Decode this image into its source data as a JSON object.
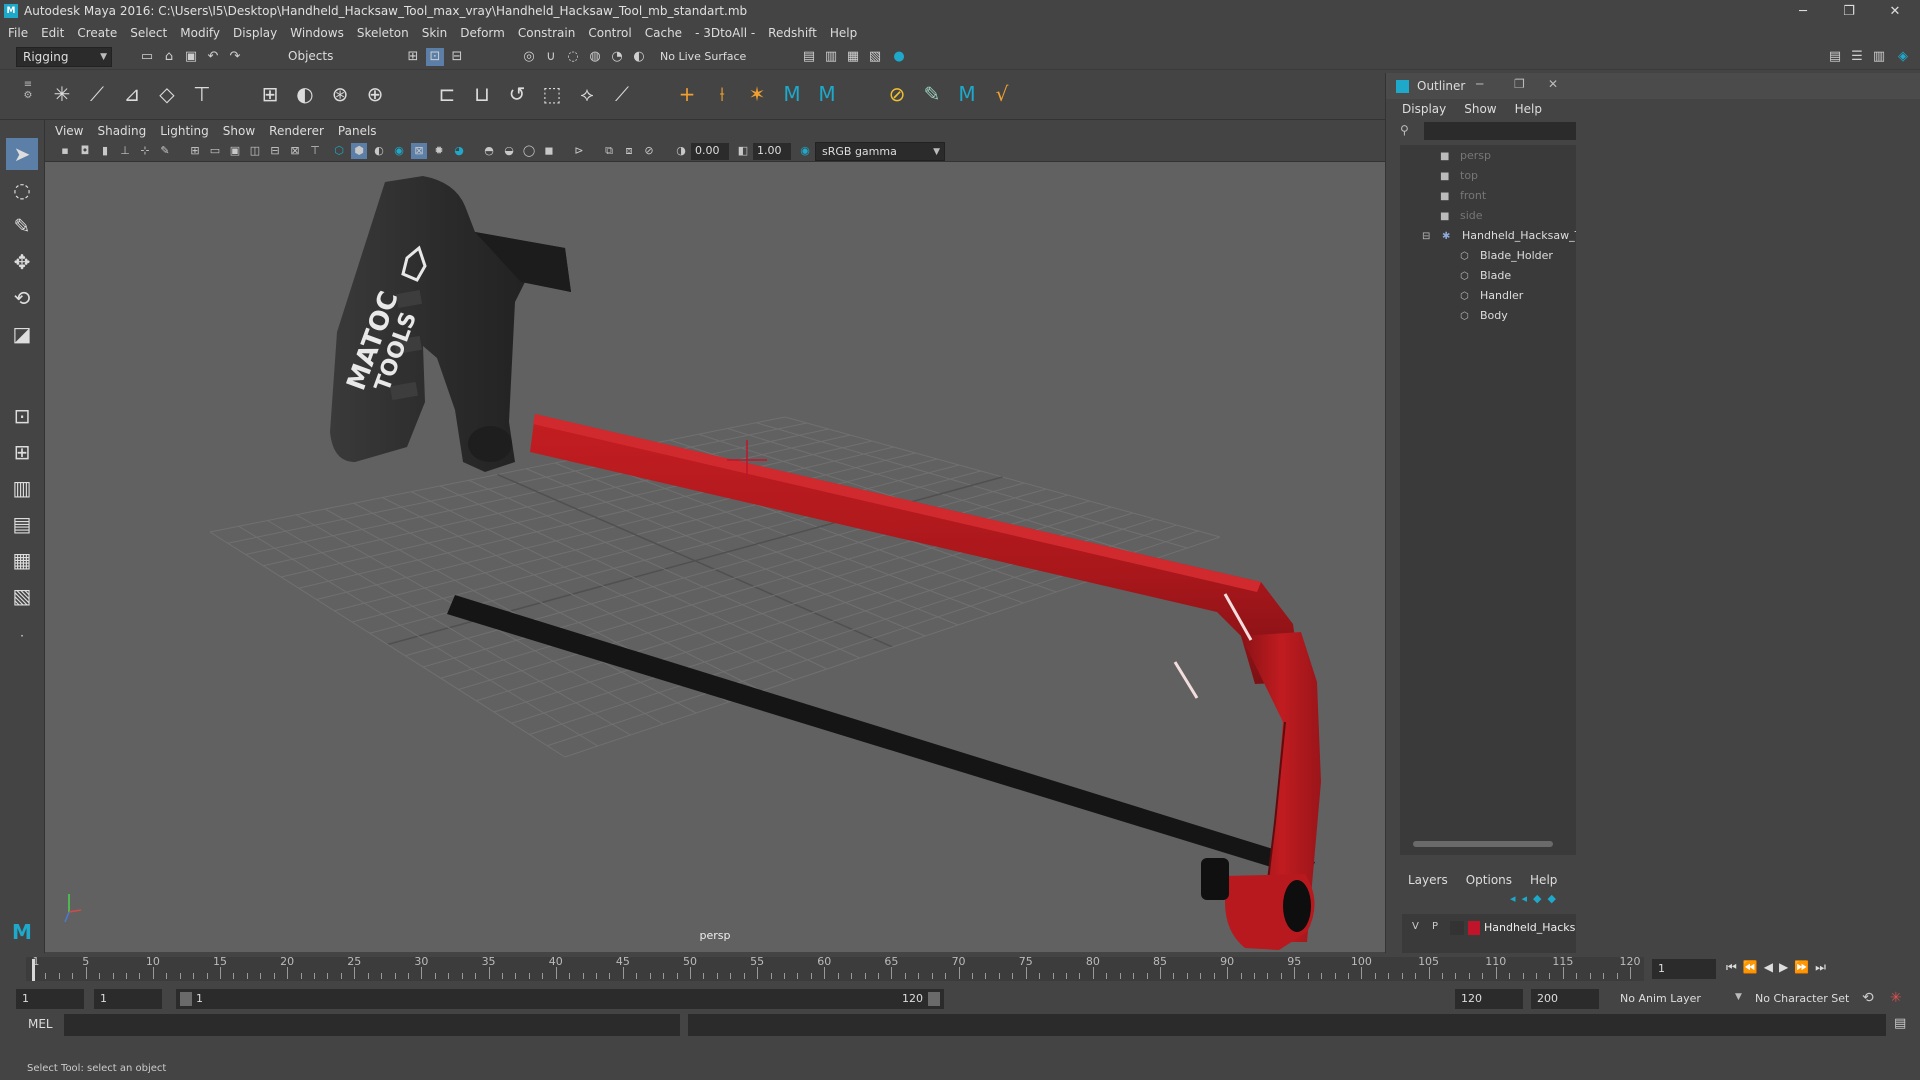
{
  "window": {
    "title": "Autodesk Maya 2016: C:\\Users\\I5\\Desktop\\Handheld_Hacksaw_Tool_max_vray\\Handheld_Hacksaw_Tool_mb_standart.mb",
    "min_glyph": "─",
    "max_glyph": "❐",
    "close_glyph": "✕"
  },
  "menubar": [
    "File",
    "Edit",
    "Create",
    "Select",
    "Modify",
    "Display",
    "Windows",
    "Skeleton",
    "Skin",
    "Deform",
    "Constrain",
    "Control",
    "Cache",
    "- 3DtoAll -",
    "Redshift",
    "Help"
  ],
  "statusline": {
    "menuset": "Rigging",
    "selection_mode": "Objects",
    "live_surface": "No Live Surface"
  },
  "viewport": {
    "menus": [
      "View",
      "Shading",
      "Lighting",
      "Show",
      "Renderer",
      "Panels"
    ],
    "exposure": "0.00",
    "gamma": "1.00",
    "color_space": "sRGB gamma",
    "camera_label": "persp",
    "saw_brand_line1": "MATOC",
    "saw_brand_line2": "TOOLS"
  },
  "outliner": {
    "title": "Outliner",
    "menus": [
      "Display",
      "Show",
      "Help"
    ],
    "items": [
      {
        "label": "persp",
        "type": "camera"
      },
      {
        "label": "top",
        "type": "camera"
      },
      {
        "label": "front",
        "type": "camera"
      },
      {
        "label": "side",
        "type": "camera"
      },
      {
        "label": "Handheld_Hacksaw_Tool_n",
        "type": "group"
      },
      {
        "label": "Blade_Holder",
        "type": "mesh"
      },
      {
        "label": "Blade",
        "type": "mesh"
      },
      {
        "label": "Handler",
        "type": "mesh"
      },
      {
        "label": "Body",
        "type": "mesh"
      }
    ]
  },
  "layers": {
    "menus": [
      "Layers",
      "Options",
      "Help"
    ],
    "row": {
      "v": "V",
      "p": "P",
      "name": "Handheld_Hacksaw_To",
      "color": "#c0142a"
    }
  },
  "timeline": {
    "labels": [
      "1",
      "5",
      "10",
      "15",
      "20",
      "25",
      "30",
      "35",
      "40",
      "45",
      "50",
      "55",
      "60",
      "65",
      "70",
      "75",
      "80",
      "85",
      "90",
      "95",
      "100",
      "105",
      "110",
      "115",
      "120"
    ],
    "current_frame": "1"
  },
  "range": {
    "start": "1",
    "anim_start": "1",
    "slider_start": "1",
    "slider_end": "120",
    "end": "120",
    "anim_end": "200",
    "anim_layer": "No Anim Layer",
    "char_set": "No Character Set"
  },
  "cmdline": {
    "lang": "MEL"
  },
  "helpline": "Select Tool: select an object",
  "colors": {
    "saw_frame": "#b01a1e",
    "handle": "#2a2a2a",
    "manip": "#c0142a",
    "maya_blue": "#1ea8c9"
  }
}
